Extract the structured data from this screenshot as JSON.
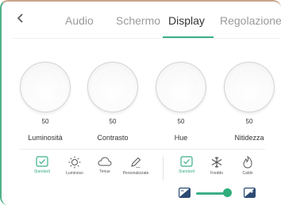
{
  "header": {
    "back_icon": "chevron-left-icon",
    "tabs": [
      {
        "label": "Audio"
      },
      {
        "label": "Schermo"
      },
      {
        "label": "Display",
        "active": true
      },
      {
        "label": "Regolazione"
      }
    ]
  },
  "knobs": [
    {
      "label": "Luminosità",
      "value": "50"
    },
    {
      "label": "Contrasto",
      "value": "50"
    },
    {
      "label": "Hue",
      "value": "50"
    },
    {
      "label": "Nitidezza",
      "value": "50"
    }
  ],
  "modes": [
    {
      "label": "Standard",
      "icon": "check-icon",
      "selected": true
    },
    {
      "label": "Luminoso",
      "icon": "sun-icon"
    },
    {
      "label": "Tenue",
      "icon": "cloud-icon"
    },
    {
      "label": "Personalizzate",
      "icon": "pencil-icon"
    }
  ],
  "color_temps": [
    {
      "label": "Standard",
      "icon": "check-icon",
      "selected": true
    },
    {
      "label": "Freddo",
      "icon": "snowflake-icon"
    },
    {
      "label": "Caldo",
      "icon": "flame-icon"
    }
  ],
  "slider": {
    "level": 1.0,
    "min_icon": "image-minus-icon",
    "max_icon": "image-plus-icon"
  },
  "colors": {
    "accent": "#3aaf86",
    "text": "#333333",
    "tab_inactive": "#9a9a9a"
  }
}
